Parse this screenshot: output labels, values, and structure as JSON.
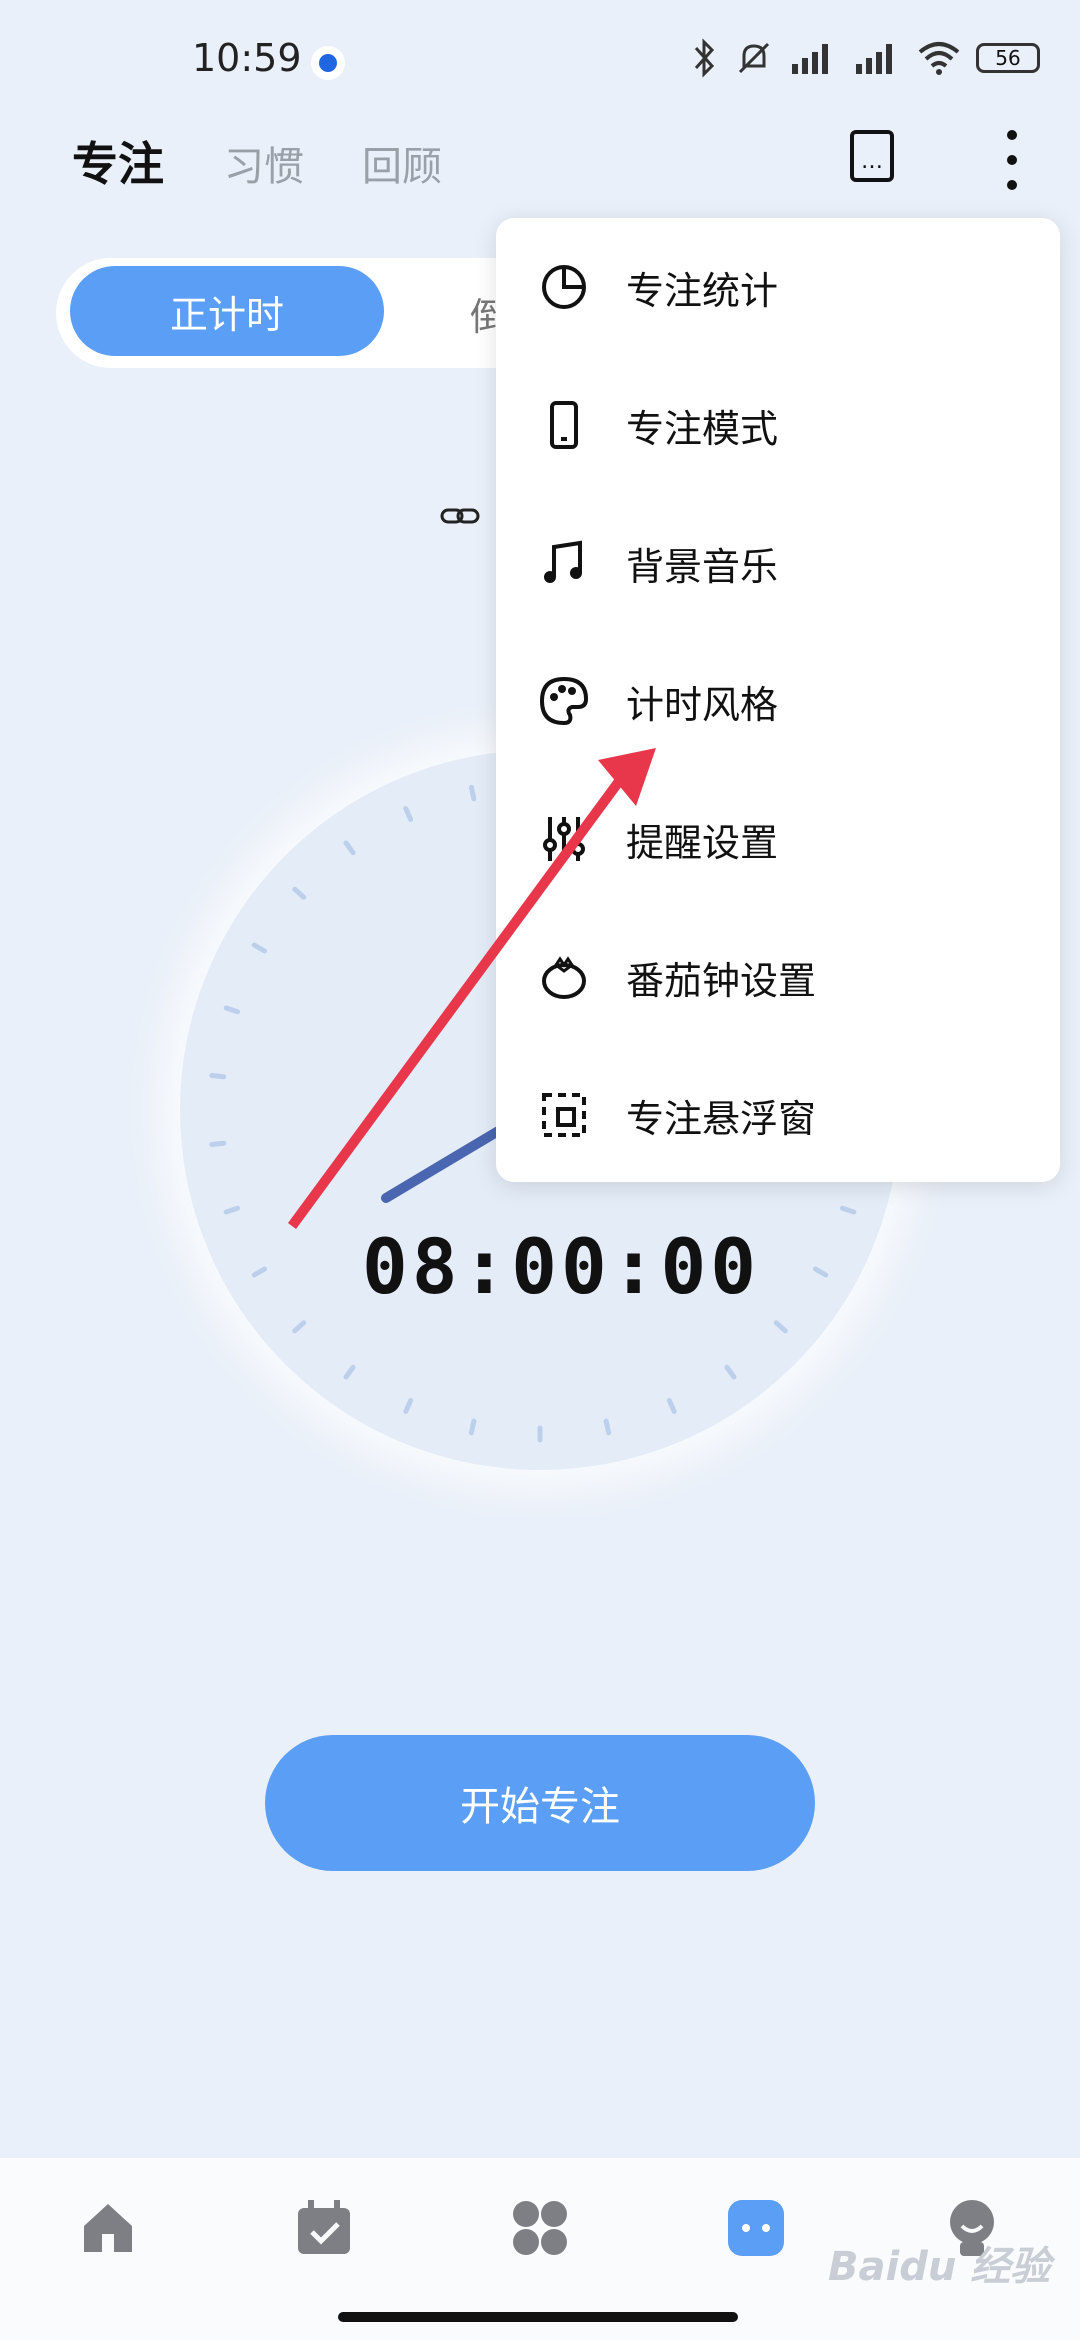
{
  "status_bar": {
    "time": "10:59",
    "battery": "56"
  },
  "header": {
    "tabs": [
      "专注",
      "习惯",
      "回顾"
    ]
  },
  "segment": {
    "active": "正计时",
    "inactive_partial": "倒"
  },
  "timer": {
    "display": "08:00:00"
  },
  "start_button": "开始专注",
  "menu": {
    "items": [
      {
        "label": "专注统计",
        "icon": "pie-chart-icon"
      },
      {
        "label": "专注模式",
        "icon": "phone-icon"
      },
      {
        "label": "背景音乐",
        "icon": "music-note-icon"
      },
      {
        "label": "计时风格",
        "icon": "palette-icon"
      },
      {
        "label": "提醒设置",
        "icon": "sliders-icon"
      },
      {
        "label": "番茄钟设置",
        "icon": "tomato-icon"
      },
      {
        "label": "专注悬浮窗",
        "icon": "floating-window-icon"
      }
    ]
  },
  "bottom_nav": [
    {
      "icon": "home-icon"
    },
    {
      "icon": "calendar-check-icon"
    },
    {
      "icon": "grid-icon"
    },
    {
      "icon": "focus-icon"
    },
    {
      "icon": "profile-icon"
    }
  ],
  "watermark": "Baidu 经验",
  "colors": {
    "accent": "#5a9ef5",
    "annotation_arrow": "#e8364a",
    "background": "#eaf0f9"
  }
}
